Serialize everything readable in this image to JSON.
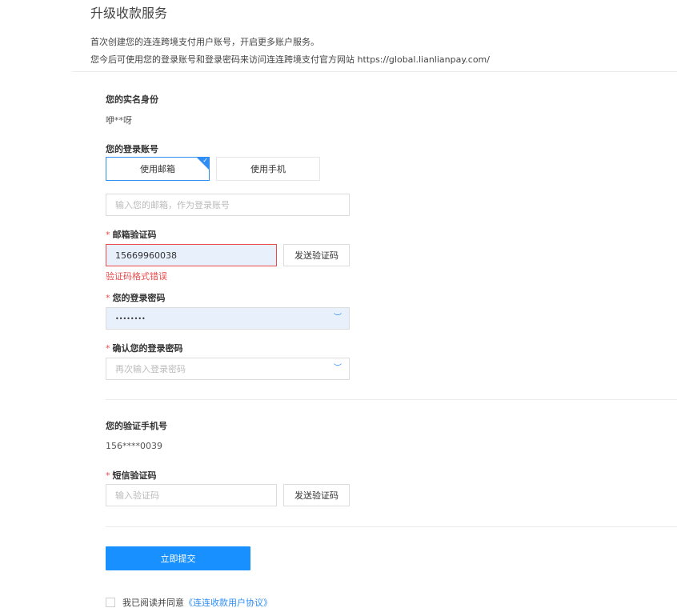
{
  "header": {
    "title": "升级收款服务",
    "intro_line1": "首次创建您的连连跨境支付用户账号，开启更多账户服务。",
    "intro_line2": "您今后可使用您的登录账号和登录密码来访问连连跨境支付官方网站 https://global.lianlianpay.com/"
  },
  "identity": {
    "label": "您的实名身份",
    "value": "咿**呀"
  },
  "login_account": {
    "label": "您的登录账号",
    "tabs": [
      "使用邮箱",
      "使用手机"
    ],
    "active_tab": "使用邮箱",
    "email_placeholder": "输入您的邮箱，作为登录账号"
  },
  "email_code": {
    "required_mark": "*",
    "label": "邮箱验证码",
    "value": "15669960038",
    "send_button": "发送验证码",
    "error": "验证码格式错误"
  },
  "password": {
    "required_mark": "*",
    "label": "您的登录密码",
    "masked_value": "••••••••"
  },
  "confirm_password": {
    "required_mark": "*",
    "label": "确认您的登录密码",
    "placeholder": "再次输入登录密码"
  },
  "phone": {
    "label": "您的验证手机号",
    "value": "156****0039"
  },
  "sms_code": {
    "required_mark": "*",
    "label": "短信验证码",
    "placeholder": "输入验证码",
    "send_button": "发送验证码"
  },
  "submit": {
    "label": "立即提交"
  },
  "agreement": {
    "text": "我已阅读并同意",
    "link": "《连连收款用户协议》"
  },
  "colors": {
    "accent": "#1890ff",
    "error": "#e84c4c",
    "autofill_bg": "#e8f0fc"
  }
}
